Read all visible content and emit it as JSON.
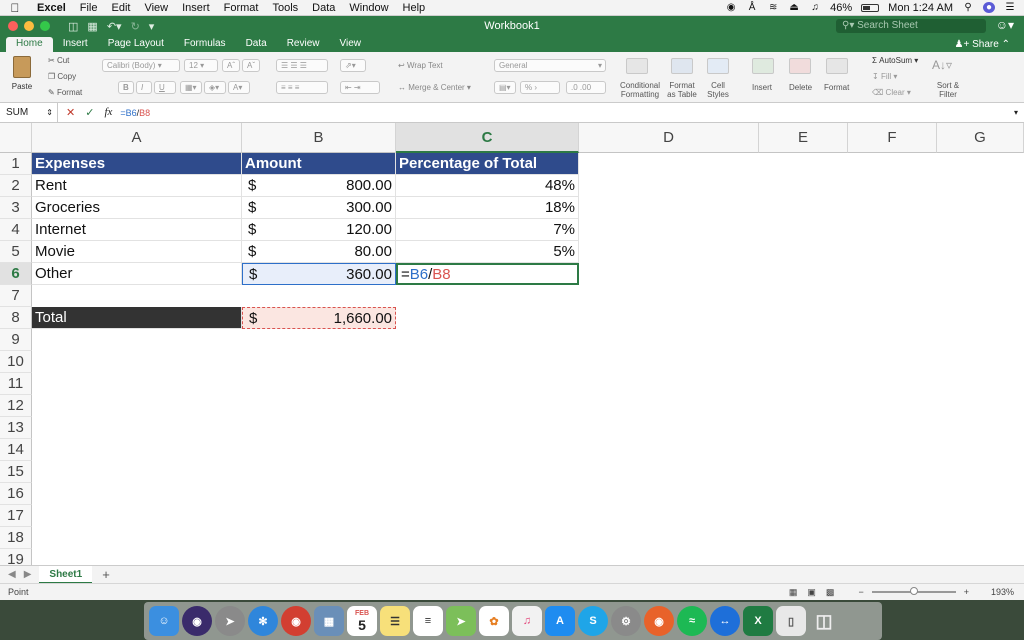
{
  "menubar": {
    "app_name": "Excel",
    "items": [
      "File",
      "Edit",
      "View",
      "Insert",
      "Format",
      "Tools",
      "Data",
      "Window",
      "Help"
    ],
    "battery": "46%",
    "clock": "Mon 1:24 AM"
  },
  "window": {
    "title": "Workbook1",
    "search_placeholder": "Search Sheet"
  },
  "ribbon": {
    "tabs": [
      "Home",
      "Insert",
      "Page Layout",
      "Formulas",
      "Data",
      "Review",
      "View"
    ],
    "share_label": "Share",
    "paste_label": "Paste",
    "cut_label": "Cut",
    "copy_label": "Copy",
    "format_label": "Format",
    "font_name": "Calibri (Body)",
    "font_size": "12",
    "bold": "B",
    "italic": "I",
    "underline": "U",
    "wrap_text": "Wrap Text",
    "merge_center": "Merge & Center",
    "number_format": "General",
    "conditional_formatting": "Conditional\nFormatting",
    "format_as_table": "Format\nas Table",
    "cell_styles": "Cell\nStyles",
    "insert": "Insert",
    "delete": "Delete",
    "format_cells": "Format",
    "autosum": "AutoSum",
    "fill": "Fill",
    "clear": "Clear",
    "sort_filter": "Sort &\nFilter"
  },
  "formula_bar": {
    "name_box": "SUM",
    "fx": "fx",
    "formula_ref1": "=B6",
    "formula_sep": "/",
    "formula_ref2": "B8"
  },
  "sheet": {
    "columns": [
      "A",
      "B",
      "C",
      "D",
      "E",
      "F",
      "G"
    ],
    "rows": [
      "1",
      "2",
      "3",
      "4",
      "5",
      "6",
      "7",
      "8",
      "9",
      "10",
      "11",
      "12",
      "13",
      "14",
      "15",
      "16",
      "17",
      "18",
      "19"
    ],
    "header": {
      "a": "Expenses",
      "b": "Amount",
      "c": "Percentage of Total"
    },
    "currency_symbol": "$",
    "data_rows": [
      {
        "expense": "Rent",
        "amount": "800.00",
        "pct": "48%"
      },
      {
        "expense": "Groceries",
        "amount": "300.00",
        "pct": "18%"
      },
      {
        "expense": "Internet",
        "amount": "120.00",
        "pct": "7%"
      },
      {
        "expense": "Movie",
        "amount": "80.00",
        "pct": "5%"
      },
      {
        "expense": "Other",
        "amount": "360.00",
        "pct": ""
      }
    ],
    "editing": {
      "eq": "=",
      "ref1": "B6",
      "sep": "/",
      "ref2": "B8"
    },
    "total": {
      "label": "Total",
      "amount": "1,660.00"
    }
  },
  "sheet_tabs": {
    "active": "Sheet1",
    "add": "+"
  },
  "status": {
    "mode": "Point",
    "zoom": "193%"
  },
  "dock": {
    "calendar_month": "FEB",
    "calendar_day": "5"
  },
  "colors": {
    "accent": "#2d7a45",
    "header_fill": "#2f4b8c",
    "total_fill": "#333333",
    "ref1": "#2d6fc9",
    "ref2": "#d9534f"
  }
}
